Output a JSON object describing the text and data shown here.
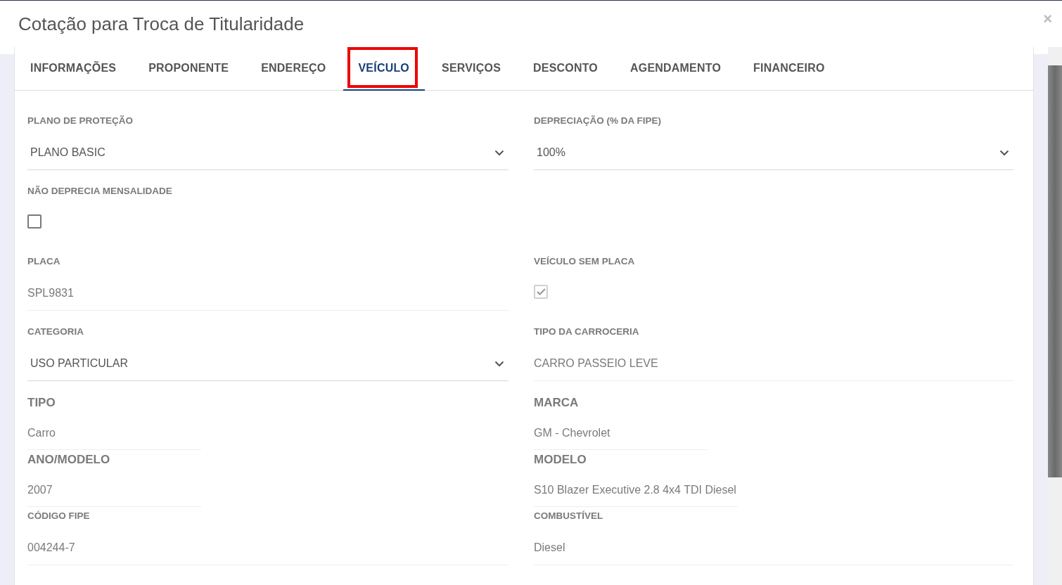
{
  "window": {
    "title": "Cotação para Troca de Titularidade",
    "close": "×"
  },
  "tabs": [
    {
      "label": "INFORMAÇÕES",
      "selected": false,
      "highlighted": false
    },
    {
      "label": "PROPONENTE",
      "selected": false,
      "highlighted": false
    },
    {
      "label": "ENDEREÇO",
      "selected": false,
      "highlighted": false
    },
    {
      "label": "VEÍCULO",
      "selected": true,
      "highlighted": true
    },
    {
      "label": "SERVIÇOS",
      "selected": false,
      "highlighted": false
    },
    {
      "label": "DESCONTO",
      "selected": false,
      "highlighted": false
    },
    {
      "label": "AGENDAMENTO",
      "selected": false,
      "highlighted": false
    },
    {
      "label": "FINANCEIRO",
      "selected": false,
      "highlighted": false
    }
  ],
  "rows": [
    [
      {
        "kind": "select",
        "label": "PLANO DE PROTEÇÃO",
        "value": "PLANO BASIC"
      },
      {
        "kind": "select",
        "label": "DEPRECIAÇÃO (% DA FIPE)",
        "value": "100%"
      }
    ],
    [
      {
        "kind": "checkbox",
        "label": "NÃO DEPRECIA MENSALIDADE",
        "checked": false,
        "disabled": false
      }
    ],
    [
      {
        "kind": "text",
        "label": "PLACA",
        "value": "SPL9831"
      },
      {
        "kind": "checkbox",
        "label": "VEÍCULO SEM PLACA",
        "checked": true,
        "disabled": true
      }
    ],
    [
      {
        "kind": "select",
        "label": "CATEGORIA",
        "value": "USO PARTICULAR"
      },
      {
        "kind": "text",
        "label": "TIPO DA CARROCERIA",
        "value": "CARRO PASSEIO LEVE"
      }
    ],
    [
      {
        "kind": "info",
        "label": "TIPO",
        "value": "Carro"
      },
      {
        "kind": "info",
        "label": "MARCA",
        "value": "GM - Chevrolet"
      }
    ],
    [
      {
        "kind": "info",
        "label": "ANO/MODELO",
        "value": "2007"
      },
      {
        "kind": "info",
        "label": "MODELO",
        "value": "S10 Blazer Executive 2.8 4x4 TDI Diesel"
      }
    ],
    [
      {
        "kind": "text",
        "label": "CÓDIGO FIPE",
        "value": "004244-7"
      },
      {
        "kind": "text",
        "label": "COMBUSTÍVEL",
        "value": "Diesel"
      }
    ]
  ]
}
